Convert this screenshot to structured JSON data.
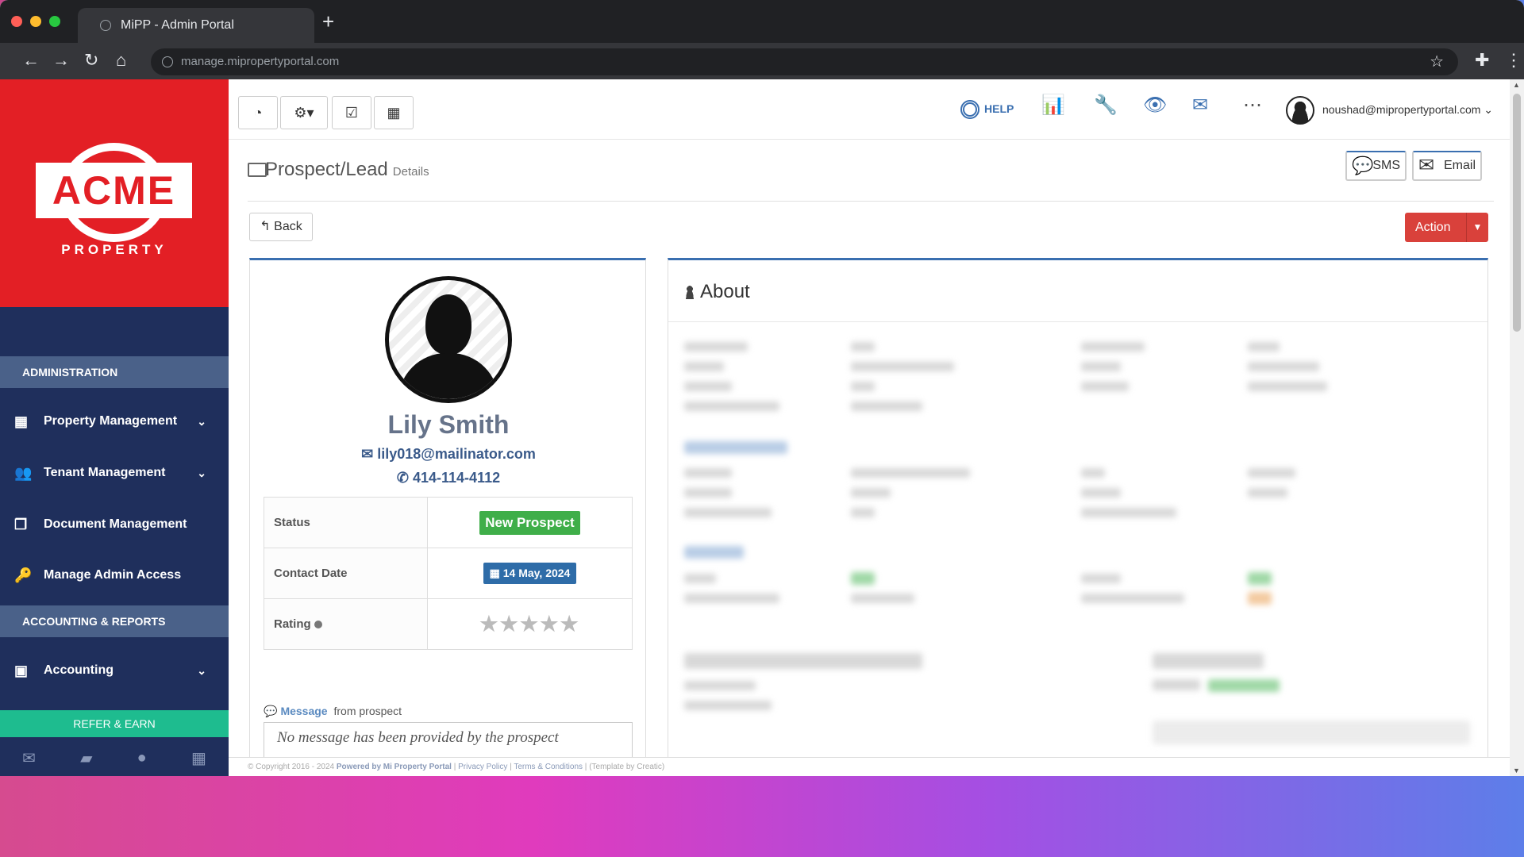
{
  "browser": {
    "tab_title": "MiPP - Admin Portal",
    "url": "manage.mipropertyportal.com",
    "new_tab_symbol": "+"
  },
  "logo": {
    "text": "ACME",
    "subtext": "PROPERTY"
  },
  "sidebar": {
    "section_admin": "ADMINISTRATION",
    "items": [
      {
        "label": "Property Management",
        "icon": "building-icon",
        "has_chevron": true
      },
      {
        "label": "Tenant Management",
        "icon": "users-icon",
        "has_chevron": true
      },
      {
        "label": "Document Management",
        "icon": "documents-icon",
        "has_chevron": false
      },
      {
        "label": "Manage Admin Access",
        "icon": "key-icon",
        "has_chevron": false
      }
    ],
    "section_accounting": "ACCOUNTING & REPORTS",
    "accounting_item": {
      "label": "Accounting",
      "icon": "money-icon",
      "has_chevron": true
    },
    "refer": "REFER & EARN"
  },
  "topbar": {
    "help_label": "HELP",
    "user_email": "noushad@mipropertyportal.com"
  },
  "page": {
    "title": "Prospect/Lead",
    "subtitle": "Details",
    "sms_label": "SMS",
    "email_label": "Email",
    "back_label": "Back",
    "action_label": "Action"
  },
  "profile": {
    "name": "Lily Smith",
    "email": "lily018@mailinator.com",
    "phone": "414-114-4112",
    "status_label": "Status",
    "status_value": "New Prospect",
    "contact_date_label": "Contact Date",
    "contact_date_value": "14 May, 2024",
    "rating_label": "Rating",
    "rating_value": 0,
    "rating_max": 5,
    "message_label": "Message",
    "message_label_suffix": "from prospect",
    "message_text": "No message has been provided by the prospect"
  },
  "about": {
    "title": "About"
  },
  "footer": {
    "copyright": "© Copyright 2016 - 2024",
    "powered": "Powered by Mi Property Portal",
    "privacy": "Privacy Policy",
    "terms": "Terms & Conditions",
    "template": "(Template by Creatic)"
  },
  "colors": {
    "brand_red": "#e31f25",
    "sidebar_navy": "#1f2f5c",
    "accent_blue": "#3a6fb0",
    "status_green": "#3fae49",
    "action_red": "#d9413b"
  }
}
